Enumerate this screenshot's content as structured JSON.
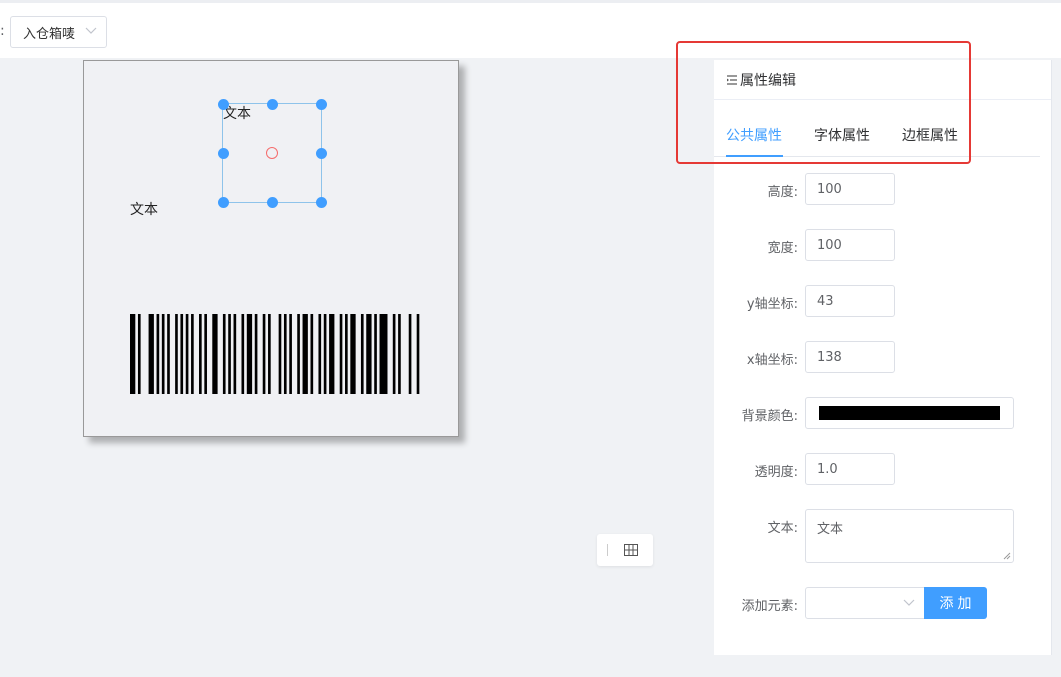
{
  "toolbar": {
    "colon": ":",
    "template_type_value": "入仓箱唛"
  },
  "canvas": {
    "text_selected": "文本",
    "text_other": "文本",
    "barcode_bars": [
      2,
      1,
      1,
      3,
      2,
      1,
      1,
      1,
      1,
      1,
      1,
      2,
      1,
      1,
      1,
      1,
      1,
      1,
      1,
      2,
      1,
      1,
      1,
      2,
      2,
      2,
      1,
      1,
      1,
      1,
      1,
      2,
      1,
      1,
      2,
      1,
      1,
      2,
      1,
      1,
      1,
      3,
      1,
      1,
      1,
      1,
      1,
      2,
      1,
      1,
      2,
      1,
      1,
      2,
      1,
      1,
      1,
      1,
      2,
      2,
      1,
      1,
      1,
      1,
      2,
      2,
      1,
      1,
      2,
      1,
      1,
      1,
      3,
      2,
      1,
      1,
      1,
      3,
      1,
      2,
      1,
      1
    ]
  },
  "panel": {
    "title": "属性编辑",
    "tabs": [
      {
        "label": "公共属性",
        "active": true
      },
      {
        "label": "字体属性",
        "active": false
      },
      {
        "label": "边框属性",
        "active": false
      }
    ],
    "fields": {
      "height": {
        "label": "高度:",
        "value": "100"
      },
      "width": {
        "label": "宽度:",
        "value": "100"
      },
      "y": {
        "label": "y轴坐标:",
        "value": "43"
      },
      "x": {
        "label": "x轴坐标:",
        "value": "138"
      },
      "bg_color": {
        "label": "背景颜色:",
        "value": "#000000"
      },
      "opacity": {
        "label": "透明度:",
        "value": "1.0"
      },
      "text": {
        "label": "文本:",
        "value": "文本"
      },
      "add_element": {
        "label": "添加元素:",
        "value": ""
      }
    },
    "add_button_label": "添加"
  },
  "colors": {
    "accent": "#409eff",
    "highlight": "#e53935",
    "handle": "#409eff",
    "center": "#f56c6c"
  }
}
